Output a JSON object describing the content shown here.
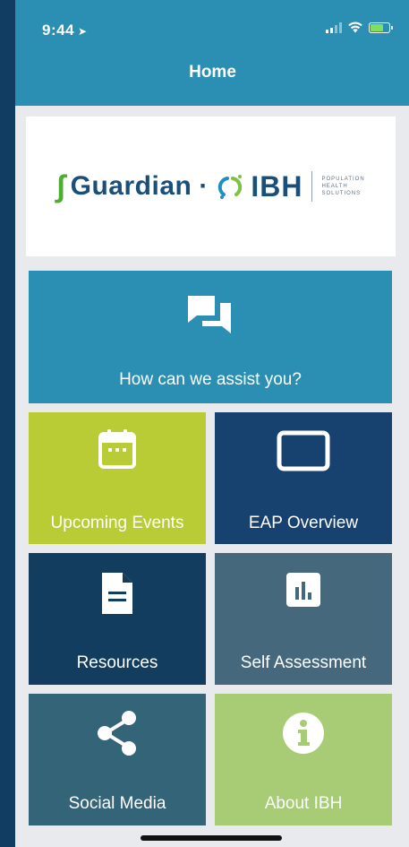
{
  "status_bar": {
    "time": "9:44",
    "location_arrow": "location-arrow-icon",
    "battery_color": "#7fe05d"
  },
  "nav": {
    "title": "Home"
  },
  "logo": {
    "brand_left": "Guardian",
    "separator": "·",
    "brand_right": "IBH",
    "tagline_lines": [
      "POPULATION",
      "HEALTH",
      "SOLUTIONS"
    ]
  },
  "tiles": {
    "assist": {
      "label": "How can we assist you?",
      "icon": "chat-icon",
      "color": "#2a8fb2"
    },
    "events": {
      "label": "Upcoming Events",
      "icon": "calendar-icon",
      "color": "#b9cc35"
    },
    "eap": {
      "label": "EAP Overview",
      "icon": "tablet-icon",
      "color": "#17416e"
    },
    "resources": {
      "label": "Resources",
      "icon": "document-icon",
      "color": "#133d5e"
    },
    "self_assessment": {
      "label": "Self Assessment",
      "icon": "bar-chart-icon",
      "color": "#45687c"
    },
    "social": {
      "label": "Social Media",
      "icon": "share-icon",
      "color": "#346477"
    },
    "about": {
      "label": "About IBH",
      "icon": "info-icon",
      "color": "#a8cc75"
    }
  }
}
